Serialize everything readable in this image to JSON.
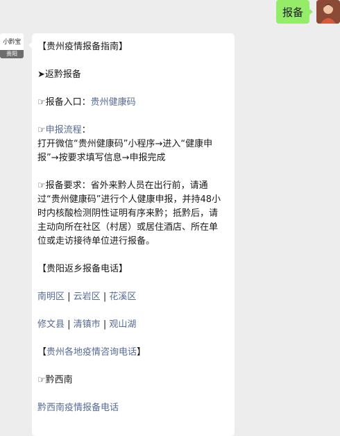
{
  "user_message": {
    "text": "报备"
  },
  "bot": {
    "avatar_logo_text": "小黔宝",
    "avatar_tag": "贵阳"
  },
  "message": {
    "title": "【贵州疫情报备指南】",
    "section_return": "➤返黔报备",
    "entry_prefix": "☞报备入口：",
    "entry_link": "贵州健康码",
    "process_prefix": "☞",
    "process_link": "申报流程",
    "process_colon": "：",
    "process_body": "打开微信“贵州健康码”小程序→进入“健康申报”→按要求填写信息→申报完成",
    "requirement_body": "☞报备要求：省外来黔人员在出行前，请通过“贵州健康码”进行个人健康申报，并持48小时内核酸检测阴性证明有序来黔；抵黔后，请主动向所在社区（村居）或居住酒店、所在单位或走访接待单位进行报备。",
    "guiyang_header": "【贵阳返乡报备电话】",
    "districts_row1": [
      "南明区",
      "云岩区",
      "花溪区"
    ],
    "districts_row2": [
      "修文县",
      "清镇市",
      "观山湖"
    ],
    "separator": " | ",
    "province_header_open": "【",
    "province_header_link": "贵州各地疫情咨询电话",
    "province_header_close": "】",
    "qianxinan_label": "☞黔西南",
    "qianxinan_link": "黔西南疫情报备电话"
  }
}
